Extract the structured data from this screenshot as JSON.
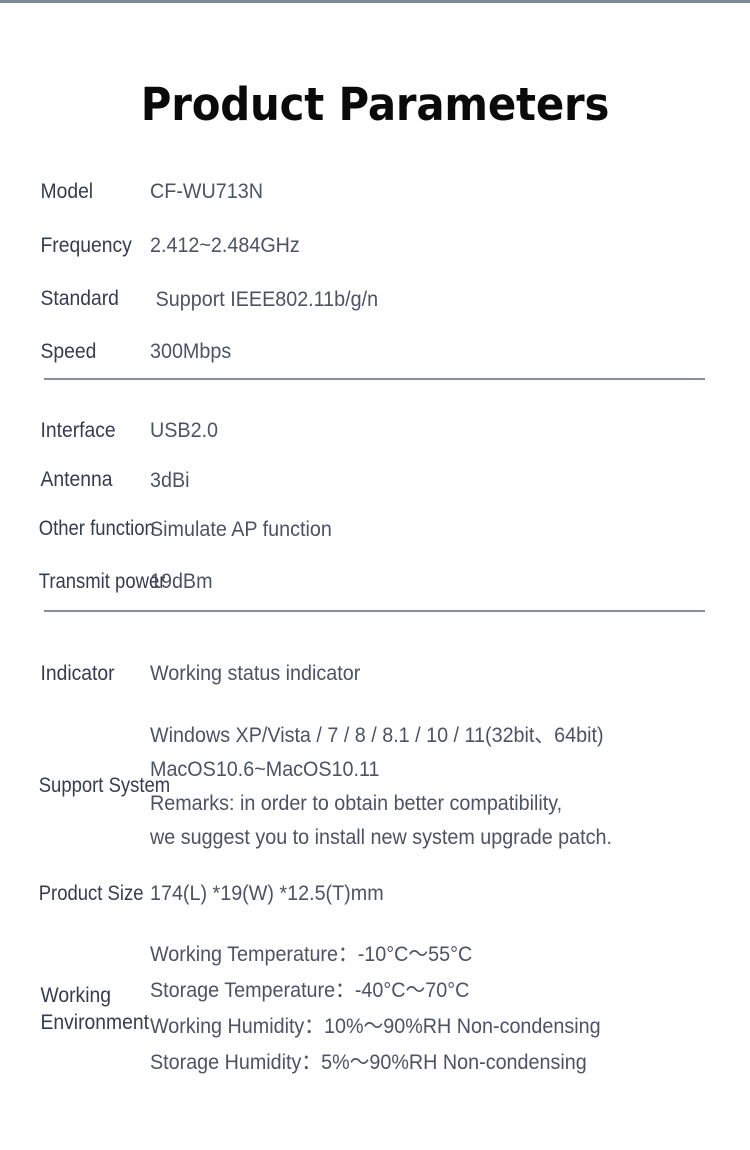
{
  "page": {
    "title": "Product Parameters",
    "accent_strip_color": "#7b8c98",
    "divider_color": "#8b8d9e",
    "label_color": "#363c50",
    "value_color": "#4d5265",
    "title_color": "#0a0a0a",
    "background": "#ffffff"
  },
  "groups": [
    {
      "id": "group-basic",
      "rows": [
        {
          "label": "Model",
          "value": "CF-WU713N"
        },
        {
          "label": "Frequency",
          "value": "2.412~2.484GHz"
        },
        {
          "label": "Standard",
          "value": "Support IEEE802.11b/g/n"
        },
        {
          "label": "Speed",
          "value": "300Mbps"
        }
      ]
    },
    {
      "id": "group-hardware",
      "rows": [
        {
          "label": "Interface",
          "value": "USB2.0"
        },
        {
          "label": "Antenna",
          "value": "3dBi"
        },
        {
          "label": "Other function",
          "value": "Simulate AP function"
        },
        {
          "label": "Transmit power",
          "value": "19dBm"
        }
      ]
    },
    {
      "id": "group-system",
      "rows": [
        {
          "label": "Indicator",
          "value": "Working status indicator"
        },
        {
          "label": "Support System",
          "lines": [
            "Windows XP/Vista / 7 / 8 / 8.1 / 10 / 11(32bit、64bit)",
            "MacOS10.6~MacOS10.11",
            "Remarks: in order to obtain better compatibility,",
            "we suggest you to install new system upgrade patch."
          ]
        },
        {
          "label": "Product Size",
          "value": "174(L) *19(W) *12.5(T)mm"
        },
        {
          "label": "Working Environment",
          "lines": [
            "Working Temperature：-10°C〜55°C",
            "Storage Temperature：-40°C〜70°C",
            "Working Humidity：10%〜90%RH Non-condensing",
            "Storage Humidity：5%〜90%RH Non-condensing"
          ]
        }
      ]
    }
  ]
}
